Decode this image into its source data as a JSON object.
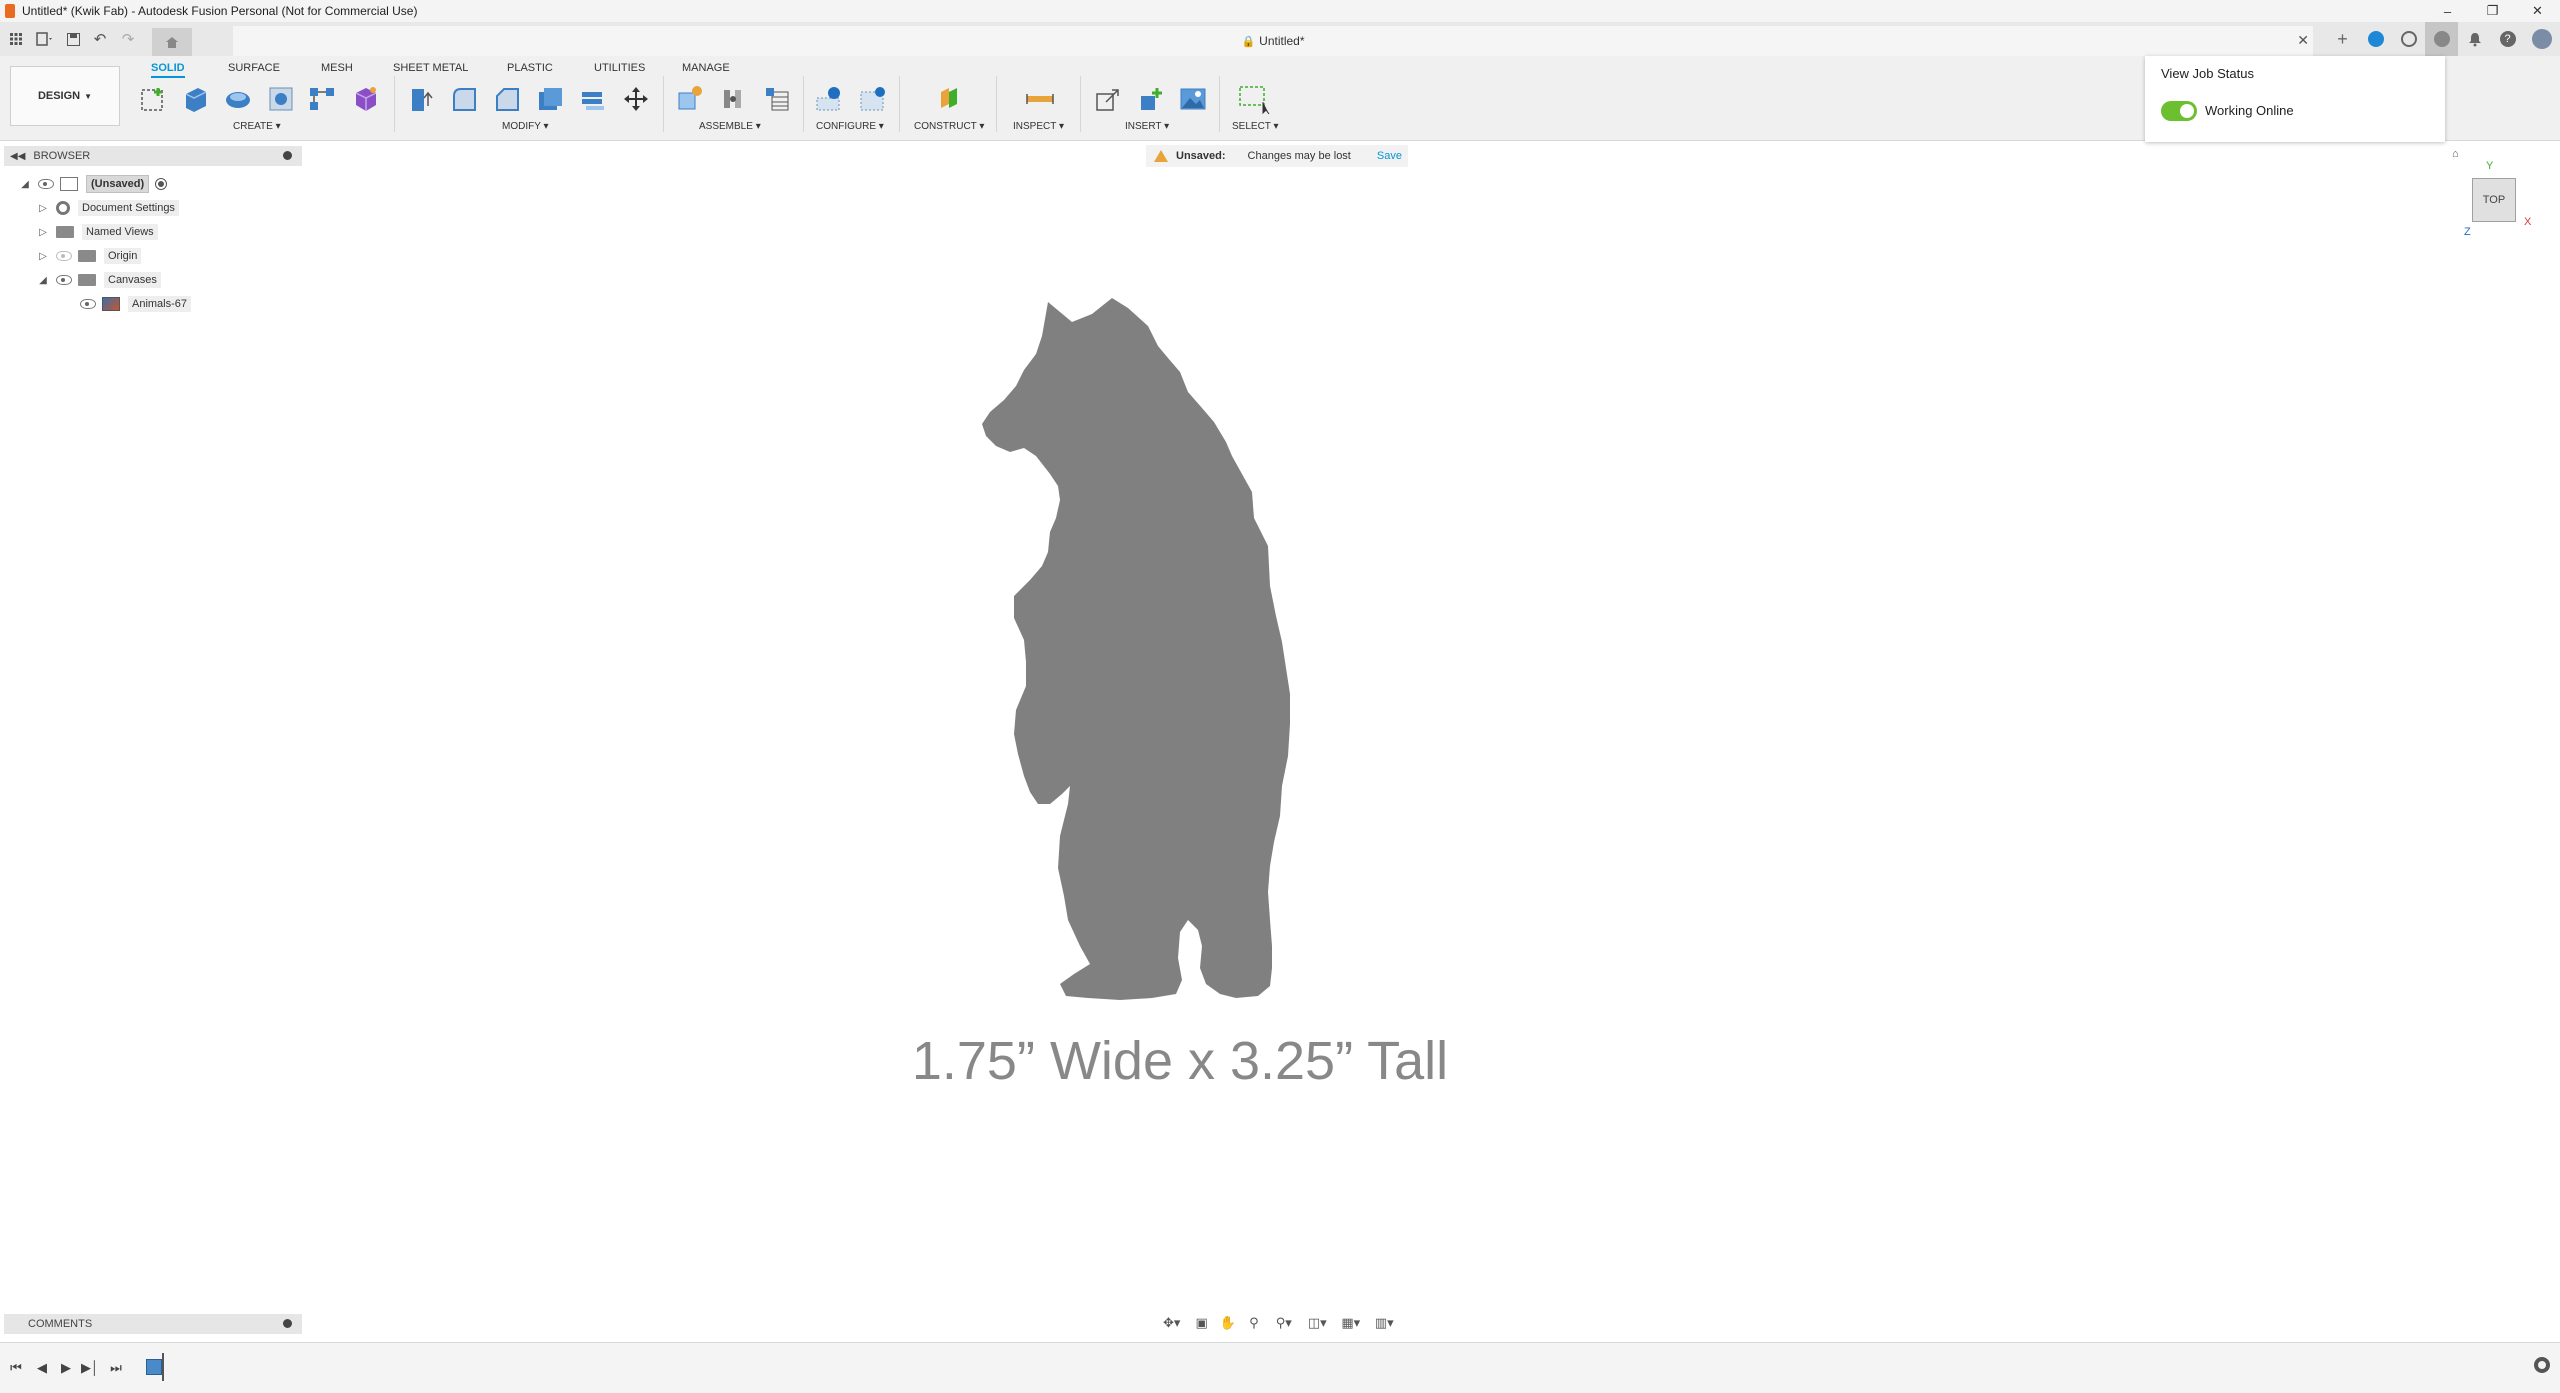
{
  "window": {
    "title": "Untitled* (Kwik Fab) - Autodesk Fusion Personal (Not for Commercial Use)",
    "controls": [
      "minimize",
      "restore",
      "close"
    ]
  },
  "document_tab": {
    "title": "Untitled*"
  },
  "workspace": {
    "design_label": "DESIGN"
  },
  "ribbon": {
    "tabs": [
      {
        "label": "SOLID",
        "active": true
      },
      {
        "label": "SURFACE"
      },
      {
        "label": "MESH"
      },
      {
        "label": "SHEET METAL"
      },
      {
        "label": "PLASTIC"
      },
      {
        "label": "UTILITIES"
      },
      {
        "label": "MANAGE"
      }
    ],
    "groups": {
      "create": "CREATE",
      "modify": "MODIFY",
      "assemble": "ASSEMBLE",
      "configure": "CONFIGURE",
      "construct": "CONSTRUCT",
      "inspect": "INSPECT",
      "insert": "INSERT",
      "select": "SELECT"
    }
  },
  "job_status": {
    "title": "View Job Status",
    "status_label": "Working Online",
    "online": true
  },
  "browser": {
    "header": "BROWSER",
    "root": "(Unsaved)",
    "items": [
      {
        "label": "Document Settings"
      },
      {
        "label": "Named Views"
      },
      {
        "label": "Origin"
      },
      {
        "label": "Canvases"
      },
      {
        "label": "Animals-67"
      }
    ]
  },
  "unsaved_banner": {
    "label": "Unsaved:",
    "message": "Changes may be lost",
    "action": "Save"
  },
  "viewcube": {
    "face": "TOP",
    "axes": {
      "y": "Y",
      "x": "X",
      "z": "Z"
    }
  },
  "canvas": {
    "dimension_text": "1.75” Wide x 3.25” Tall"
  },
  "comments": {
    "header": "COMMENTS"
  },
  "colors": {
    "accent": "#0696d7",
    "toggle_on": "#6cbf2e",
    "warning": "#e8a33a",
    "silhouette": "#808080"
  }
}
